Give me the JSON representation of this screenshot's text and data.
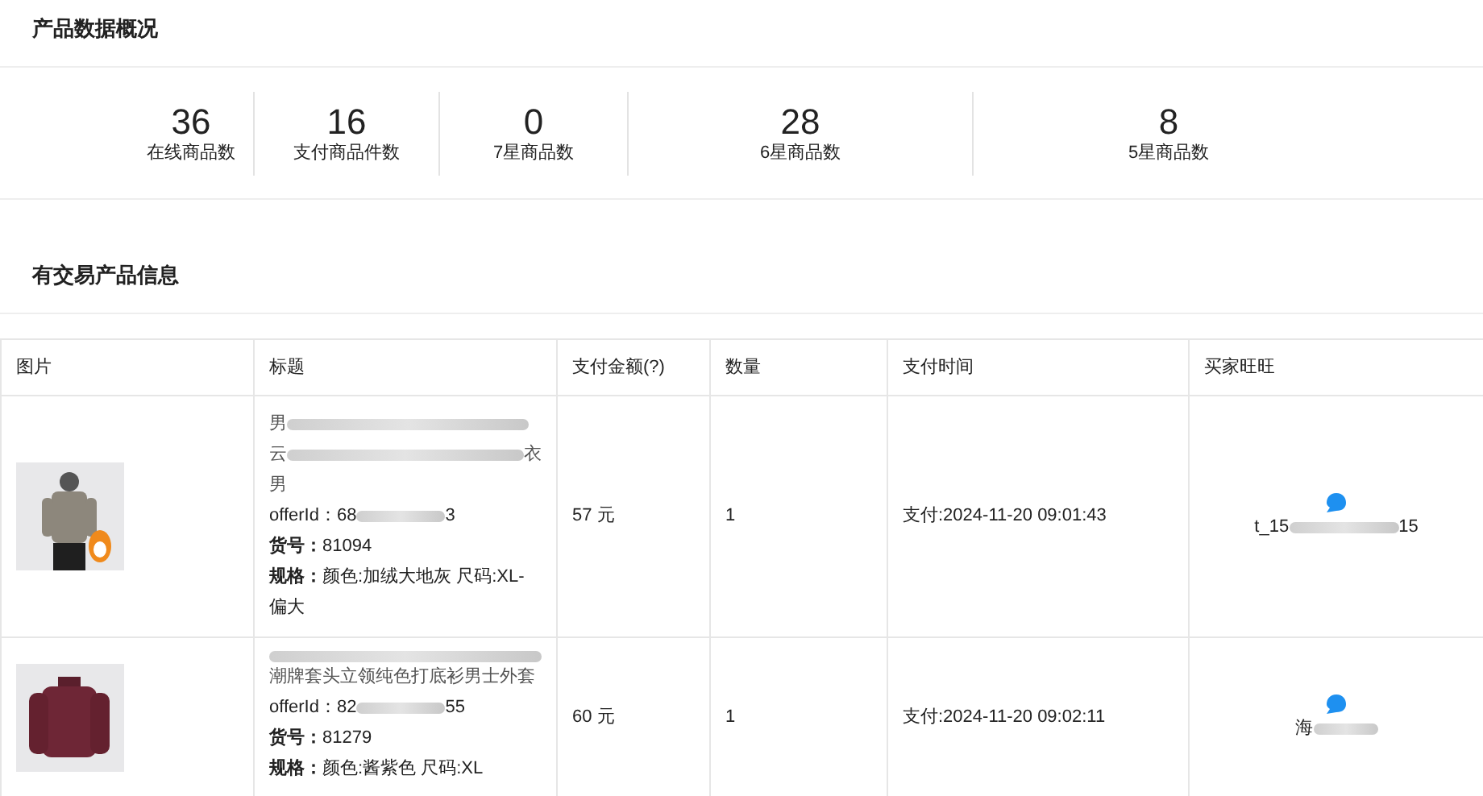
{
  "overview": {
    "title": "产品数据概况",
    "stats": [
      {
        "value": "36",
        "label": "在线商品数"
      },
      {
        "value": "16",
        "label": "支付商品件数"
      },
      {
        "value": "0",
        "label": "7星商品数"
      },
      {
        "value": "28",
        "label": "6星商品数"
      },
      {
        "value": "8",
        "label": "5星商品数"
      }
    ]
  },
  "trades": {
    "title": "有交易产品信息",
    "columns": [
      "图片",
      "标题",
      "支付金额(?)",
      "数量",
      "支付时间",
      "买家旺旺"
    ],
    "rows": [
      {
        "image": {
          "kind": "picture"
        },
        "title_lines": [
          {
            "start": "男",
            "redacted": true
          },
          {
            "start": "云",
            "redacted": true,
            "end": "衣"
          },
          {
            "start": "男",
            "redacted": false
          }
        ],
        "offer_id": {
          "start": "offerId：68",
          "redacted": true,
          "end": "3"
        },
        "sku_label": "货号：",
        "sku": "81094",
        "spec_label": "规格：",
        "spec": "颜色:加绒大地灰 尺码:XL-偏大",
        "amount": "57 元",
        "quantity": "1",
        "paid_at": "支付:2024-11-20 09:01:43",
        "buyer": {
          "start": "t_15",
          "redacted": true,
          "end": "15"
        }
      },
      {
        "image": {
          "kind": "picture"
        },
        "title_lines": [
          {
            "redacted": true
          },
          {
            "start": "潮牌套头立领纯色打底衫男士外套",
            "redacted": false
          }
        ],
        "offer_id": {
          "start": "offerId：82",
          "redacted": true,
          "end": "55"
        },
        "sku_label": "货号：",
        "sku": "81279",
        "spec_label": "规格：",
        "spec": "颜色:酱紫色 尺码:XL",
        "amount": "60 元",
        "quantity": "1",
        "paid_at": "支付:2024-11-20 09:02:11",
        "buyer": {
          "start": "海",
          "redacted": true
        }
      }
    ]
  }
}
